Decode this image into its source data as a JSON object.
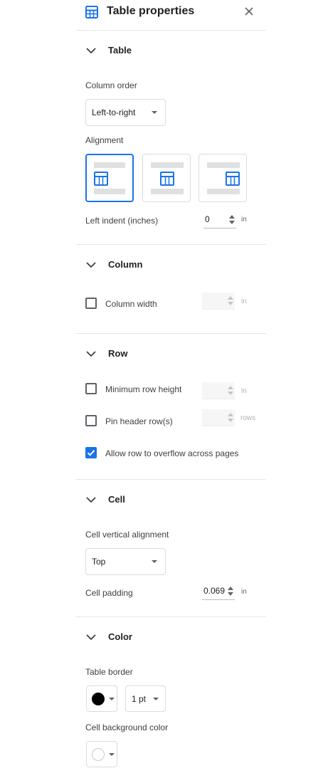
{
  "header": {
    "title": "Table properties",
    "icon": "table-icon",
    "close_icon": "close-icon"
  },
  "sections": {
    "table": {
      "title": "Table",
      "column_order_label": "Column order",
      "column_order_value": "Left-to-right",
      "alignment_label": "Alignment",
      "alignment_options": [
        "left",
        "center",
        "right"
      ],
      "alignment_selected": "left",
      "left_indent_label": "Left indent (inches)",
      "left_indent_value": "0",
      "left_indent_unit": "in"
    },
    "column": {
      "title": "Column",
      "column_width_label": "Column width",
      "column_width_checked": false,
      "column_width_value": "",
      "column_width_unit": "in"
    },
    "row": {
      "title": "Row",
      "min_row_height_label": "Minimum row height",
      "min_row_height_checked": false,
      "min_row_height_unit": "in",
      "pin_header_label": "Pin header row(s)",
      "pin_header_checked": false,
      "pin_header_unit": "rows",
      "overflow_label": "Allow row to overflow across pages",
      "overflow_checked": true
    },
    "cell": {
      "title": "Cell",
      "vertical_alignment_label": "Cell vertical alignment",
      "vertical_alignment_value": "Top",
      "padding_label": "Cell padding",
      "padding_value": "0.069",
      "padding_unit": "in"
    },
    "color": {
      "title": "Color",
      "table_border_label": "Table border",
      "border_color": "#000000",
      "border_width_value": "1 pt",
      "cell_bg_label": "Cell background color",
      "cell_bg_color": "#ffffff"
    }
  },
  "colors": {
    "accent": "#1a73e8",
    "divider": "#e6e6e6",
    "text": "#202124"
  }
}
